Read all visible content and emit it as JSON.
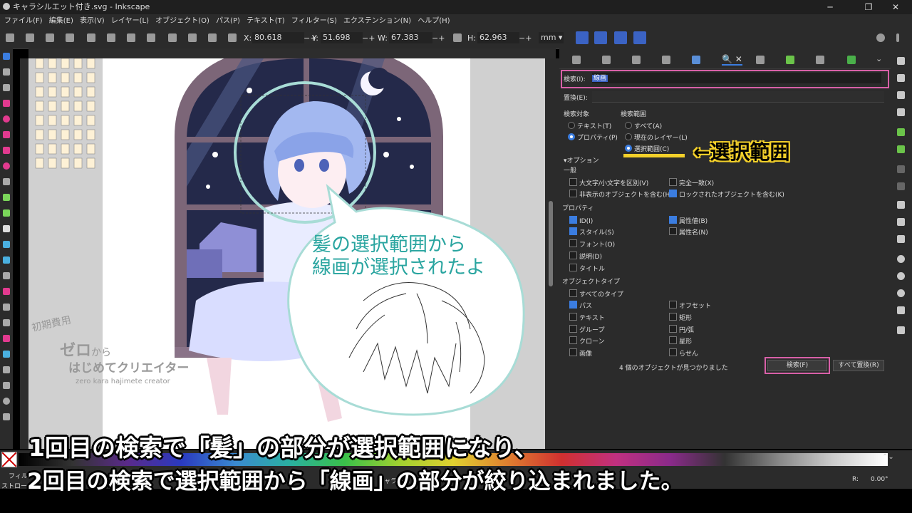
{
  "window": {
    "title": "キャラシルエット付き.svg - Inkscape"
  },
  "menu": [
    "ファイル(F)",
    "編集(E)",
    "表示(V)",
    "レイヤー(L)",
    "オブジェクト(O)",
    "パス(P)",
    "テキスト(T)",
    "フィルター(S)",
    "エクステンション(N)",
    "ヘルプ(H)"
  ],
  "toolbar": {
    "x_label": "X:",
    "x_value": "80.618",
    "y_label": "Y:",
    "y_value": "51.698",
    "w_label": "W:",
    "w_value": "67.383",
    "h_label": "H:",
    "h_value": "62.963",
    "unit": "mm"
  },
  "find_panel": {
    "search_label": "検索(I):",
    "search_value": "線画",
    "replace_label": "置換(E):",
    "target_title": "検索対象",
    "target_text": "テキスト(T)",
    "target_property": "プロパティ(P)",
    "scope_title": "検索範囲",
    "scope_all": "すべて(A)",
    "scope_layer": "現在のレイヤー(L)",
    "scope_selection": "選択範囲(C)",
    "options_title": "▾オプション",
    "general_title": "一般",
    "opt_case": "大文字/小文字を区別(V)",
    "opt_exact": "完全一致(X)",
    "opt_hidden": "非表示のオブジェクトを含む(H)",
    "opt_locked": "ロックされたオブジェクトを含む(K)",
    "props_title": "プロパティ",
    "prop_id": "ID(I)",
    "prop_attr_value": "属性値(B)",
    "prop_style": "スタイル(S)",
    "prop_attr_name": "属性名(N)",
    "prop_font": "フォント(O)",
    "prop_desc": "説明(D)",
    "prop_title": "タイトル",
    "types_title": "オブジェクトタイプ",
    "type_all": "すべてのタイプ",
    "type_path": "パス",
    "type_offset": "オフセット",
    "type_text": "テキスト",
    "type_rect": "矩形",
    "type_group": "グループ",
    "type_arc": "円/弧",
    "type_clone": "クローン",
    "type_star": "星形",
    "type_image": "画像",
    "type_spiral": "らせん",
    "result": "4 個のオブジェクトが見つかりました",
    "find_button": "検索(F)",
    "replace_all_button": "すべて置換(R)"
  },
  "annotation": {
    "arrow_text": "←選択範囲"
  },
  "speech_bubble": {
    "line1": "髪の選択範囲から",
    "line2": "線画が選択されたよ"
  },
  "watermark": {
    "tag": "初期費用",
    "line1a": "ゼロ",
    "line1b": "から",
    "line2": "はじめてクリエイター",
    "line3": "zero kara hajimete creator"
  },
  "status": {
    "fill_label": "フィル:",
    "stroke_label": "ストローク",
    "layer": "キャラー体",
    "rotation_label": "R:",
    "rotation": "0.00°"
  },
  "subtitle": {
    "line1": "1回目の検索で「髪」の部分が選択範囲になり、",
    "line2": "2回目の検索で選択範囲から「線画」の部分が絞り込まれました。"
  }
}
